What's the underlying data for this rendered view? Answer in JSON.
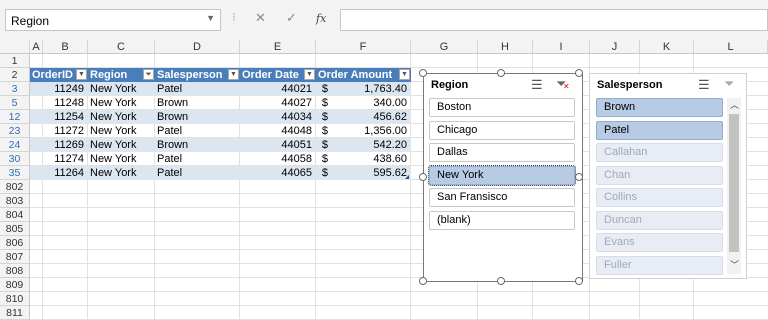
{
  "formula_bar": {
    "name_box": "Region",
    "name_box_dropdown_icon": "chevron-down",
    "cancel_icon": "✕",
    "enter_icon": "✓",
    "function_icon": "fx",
    "formula": ""
  },
  "grid": {
    "columns": [
      "A",
      "B",
      "C",
      "D",
      "E",
      "F",
      "G",
      "H",
      "I",
      "J",
      "K",
      "L"
    ],
    "row_numbers": [
      "1",
      "2",
      "3",
      "5",
      "12",
      "23",
      "24",
      "30",
      "35",
      "802",
      "803",
      "804",
      "805",
      "806",
      "807",
      "808",
      "809",
      "810",
      "811"
    ],
    "table": {
      "headers": [
        "OrderID",
        "Region",
        "Salesperson",
        "Order Date",
        "Order Amount"
      ],
      "rows": [
        [
          "11249",
          "New York",
          "Patel",
          "44021",
          "$",
          "1,763.40"
        ],
        [
          "11248",
          "New York",
          "Brown",
          "44027",
          "$",
          "340.00"
        ],
        [
          "11254",
          "New York",
          "Brown",
          "44034",
          "$",
          "456.62"
        ],
        [
          "11272",
          "New York",
          "Patel",
          "44048",
          "$",
          "1,356.00"
        ],
        [
          "11269",
          "New York",
          "Brown",
          "44051",
          "$",
          "542.20"
        ],
        [
          "11274",
          "New York",
          "Patel",
          "44058",
          "$",
          "438.60"
        ],
        [
          "11264",
          "New York",
          "Patel",
          "44065",
          "$",
          "595.62"
        ]
      ]
    }
  },
  "slicer_region": {
    "title": "Region",
    "items": [
      {
        "label": "Boston",
        "state": "normal"
      },
      {
        "label": "Chicago",
        "state": "normal"
      },
      {
        "label": "Dallas",
        "state": "normal"
      },
      {
        "label": "New York",
        "state": "selected"
      },
      {
        "label": "San Fransisco",
        "state": "normal"
      },
      {
        "label": "(blank)",
        "state": "normal"
      }
    ]
  },
  "slicer_salesperson": {
    "title": "Salesperson",
    "items": [
      {
        "label": "Brown",
        "state": "selected"
      },
      {
        "label": "Patel",
        "state": "selected"
      },
      {
        "label": "Callahan",
        "state": "nodata"
      },
      {
        "label": "Chan",
        "state": "nodata"
      },
      {
        "label": "Collins",
        "state": "nodata"
      },
      {
        "label": "Duncan",
        "state": "nodata"
      },
      {
        "label": "Evans",
        "state": "nodata"
      },
      {
        "label": "Fuller",
        "state": "nodata"
      }
    ]
  }
}
